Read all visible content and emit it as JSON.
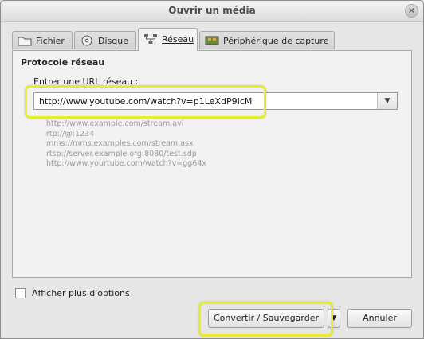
{
  "window": {
    "title": "Ouvrir un média",
    "close_glyph": "✕"
  },
  "tabs": [
    {
      "label": "Fichier",
      "icon": "folder-icon",
      "active": false
    },
    {
      "label": "Disque",
      "icon": "disc-icon",
      "active": false
    },
    {
      "label": "Réseau",
      "icon": "network-icon",
      "active": true
    },
    {
      "label": "Périphérique de capture",
      "icon": "capture-device-icon",
      "active": false
    }
  ],
  "network": {
    "section_title": "Protocole réseau",
    "url_label": "Entrer une URL réseau :",
    "url_value": "http://www.youtube.com/watch?v=p1LeXdP9IcM",
    "examples": [
      "http://www.example.com/stream.avi",
      "rtp://@:1234",
      "mms://mms.examples.com/stream.asx",
      "rtsp://server.example.org:8080/test.sdp",
      "http://www.yourtube.com/watch?v=gg64x"
    ]
  },
  "options": {
    "more_options_label": "Afficher plus d'options"
  },
  "buttons": {
    "convert_label": "Convertir / Sauvegarder",
    "dropdown_glyph": "▼",
    "cancel_label": "Annuler"
  },
  "colors": {
    "highlight": "#e6ec27"
  }
}
